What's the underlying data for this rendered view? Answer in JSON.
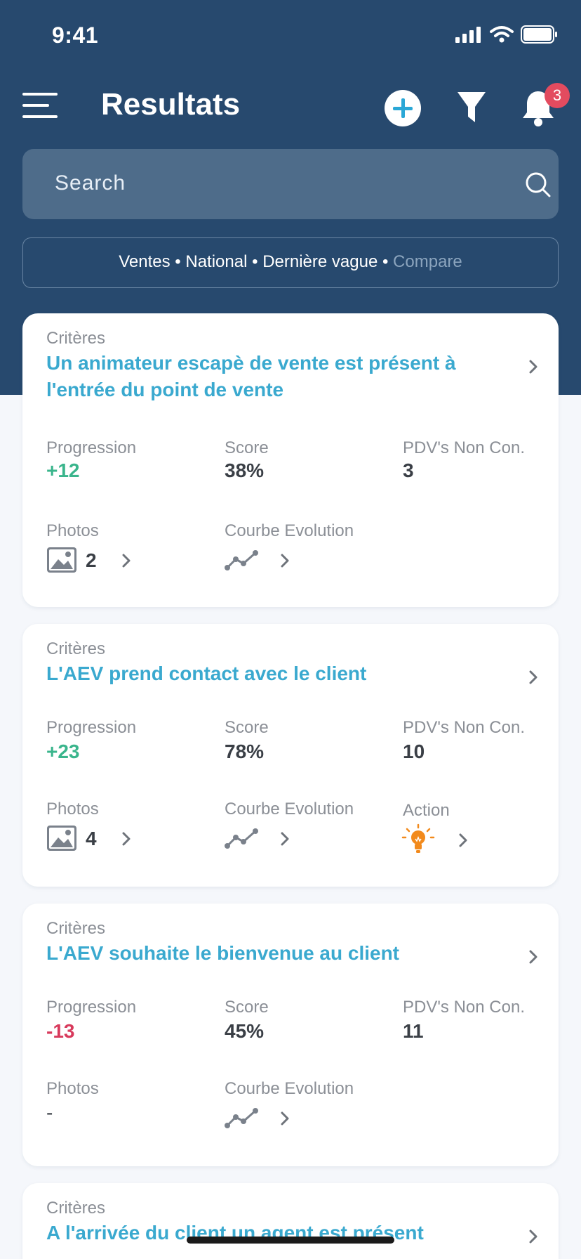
{
  "status_bar": {
    "time": "9:41"
  },
  "header": {
    "title": "Resultats",
    "notification_count": "3"
  },
  "search": {
    "placeholder": "Search"
  },
  "filter_chip": {
    "items": [
      "Ventes",
      "National",
      "Dernière vague"
    ],
    "separator": "•",
    "compare_label": "Compare"
  },
  "labels": {
    "criteria": "Critères",
    "progression": "Progression",
    "score": "Score",
    "pdv": "PDV's Non Con.",
    "photos": "Photos",
    "courbe": "Courbe Evolution",
    "action": "Action"
  },
  "cards": [
    {
      "title_line1": "Un animateur escapè de vente est présent à",
      "title_line2": "l'entrée du point de vente",
      "progression": "+12",
      "score": "38%",
      "pdv": "3",
      "photos": "2"
    },
    {
      "title_line1": "L'AEV prend contact avec le client",
      "progression": "+23",
      "score": "78%",
      "pdv": "10",
      "photos": "4"
    },
    {
      "title_line1": "L'AEV souhaite le bienvenue au client",
      "progression": "-13",
      "score": "45%",
      "pdv": "11",
      "photos": "-"
    },
    {
      "title_line1": "A l'arrivée du client un agent est présent"
    }
  ],
  "colors": {
    "header_bg": "#27496e",
    "accent_title": "#3aa9cf",
    "positive": "#3ab58c",
    "negative": "#d83a5c",
    "action_icon": "#f28a1c"
  },
  "icons": {
    "menu": "hamburger-icon",
    "add": "plus-circle-icon",
    "filter": "funnel-icon",
    "notifications": "bell-icon",
    "search": "search-icon",
    "photos": "image-icon",
    "courbe": "line-chart-icon",
    "action": "lightbulb-icon",
    "chevron": "chevron-right-icon"
  }
}
